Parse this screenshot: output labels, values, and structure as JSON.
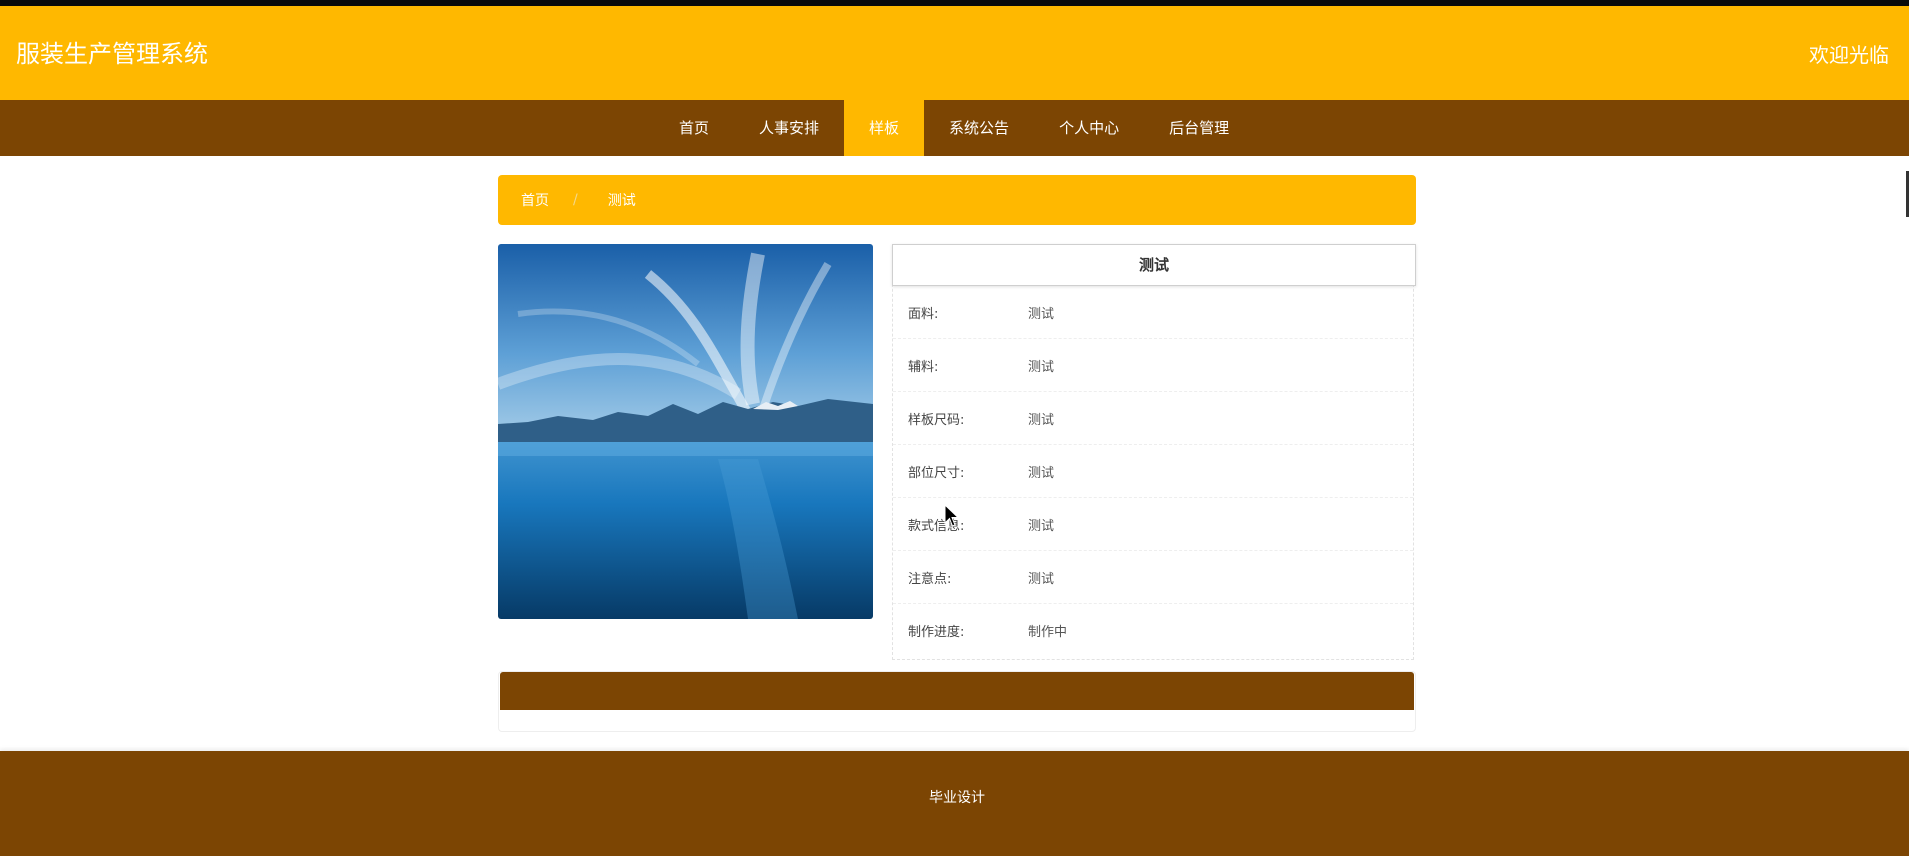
{
  "header": {
    "title": "服装生产管理系统",
    "welcome": "欢迎光临"
  },
  "nav": {
    "items": [
      {
        "label": "首页",
        "active": false
      },
      {
        "label": "人事安排",
        "active": false
      },
      {
        "label": "样板",
        "active": true
      },
      {
        "label": "系统公告",
        "active": false
      },
      {
        "label": "个人中心",
        "active": false
      },
      {
        "label": "后台管理",
        "active": false
      }
    ]
  },
  "breadcrumb": {
    "home": "首页",
    "separator": "/",
    "current": "测试"
  },
  "detail": {
    "title": "测试",
    "rows": [
      {
        "label": "面料:",
        "value": "测试"
      },
      {
        "label": "辅料:",
        "value": "测试"
      },
      {
        "label": "样板尺码:",
        "value": "测试"
      },
      {
        "label": "部位尺寸:",
        "value": "测试"
      },
      {
        "label": "款式信息:",
        "value": "测试"
      },
      {
        "label": "注意点:",
        "value": "测试"
      },
      {
        "label": "制作进度:",
        "value": "制作中"
      }
    ]
  },
  "footer": {
    "text": "毕业设计"
  },
  "colors": {
    "primary": "#ffb800",
    "secondary": "#7c4503"
  },
  "image": {
    "subject": "mountain lake landscape"
  }
}
